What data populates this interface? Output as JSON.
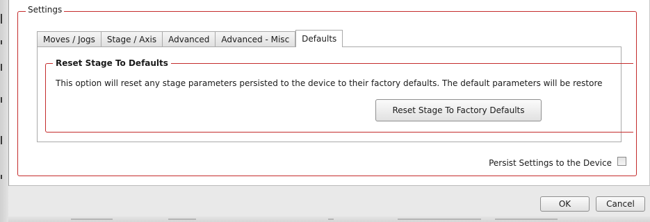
{
  "settings": {
    "legend": "Settings",
    "tabs": [
      {
        "label": "Moves / Jogs",
        "active": false
      },
      {
        "label": "Stage / Axis",
        "active": false
      },
      {
        "label": "Advanced",
        "active": false
      },
      {
        "label": "Advanced - Misc",
        "active": false
      },
      {
        "label": "Defaults",
        "active": true
      }
    ],
    "reset": {
      "legend": "Reset Stage To Defaults",
      "description": "This option will reset any stage parameters persisted to the device to their factory defaults. The default parameters will be restore",
      "button_label": "Reset Stage To Factory Defaults"
    },
    "persist": {
      "label": "Persist Settings to the Device",
      "checked": false
    }
  },
  "dialog": {
    "ok_label": "OK",
    "cancel_label": "Cancel"
  },
  "colors": {
    "group_border": "#c42b2b",
    "tab_border": "#a9a9a9",
    "dialog_background": "#e9e9e9"
  }
}
